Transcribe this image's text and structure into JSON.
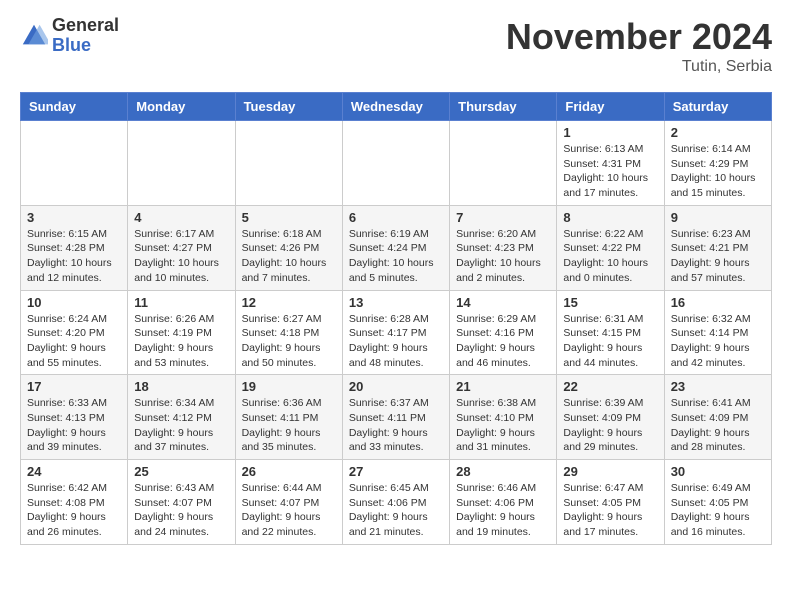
{
  "logo": {
    "general": "General",
    "blue": "Blue"
  },
  "header": {
    "month": "November 2024",
    "location": "Tutin, Serbia"
  },
  "days_of_week": [
    "Sunday",
    "Monday",
    "Tuesday",
    "Wednesday",
    "Thursday",
    "Friday",
    "Saturday"
  ],
  "weeks": [
    [
      {
        "day": "",
        "info": ""
      },
      {
        "day": "",
        "info": ""
      },
      {
        "day": "",
        "info": ""
      },
      {
        "day": "",
        "info": ""
      },
      {
        "day": "",
        "info": ""
      },
      {
        "day": "1",
        "info": "Sunrise: 6:13 AM\nSunset: 4:31 PM\nDaylight: 10 hours and 17 minutes."
      },
      {
        "day": "2",
        "info": "Sunrise: 6:14 AM\nSunset: 4:29 PM\nDaylight: 10 hours and 15 minutes."
      }
    ],
    [
      {
        "day": "3",
        "info": "Sunrise: 6:15 AM\nSunset: 4:28 PM\nDaylight: 10 hours and 12 minutes."
      },
      {
        "day": "4",
        "info": "Sunrise: 6:17 AM\nSunset: 4:27 PM\nDaylight: 10 hours and 10 minutes."
      },
      {
        "day": "5",
        "info": "Sunrise: 6:18 AM\nSunset: 4:26 PM\nDaylight: 10 hours and 7 minutes."
      },
      {
        "day": "6",
        "info": "Sunrise: 6:19 AM\nSunset: 4:24 PM\nDaylight: 10 hours and 5 minutes."
      },
      {
        "day": "7",
        "info": "Sunrise: 6:20 AM\nSunset: 4:23 PM\nDaylight: 10 hours and 2 minutes."
      },
      {
        "day": "8",
        "info": "Sunrise: 6:22 AM\nSunset: 4:22 PM\nDaylight: 10 hours and 0 minutes."
      },
      {
        "day": "9",
        "info": "Sunrise: 6:23 AM\nSunset: 4:21 PM\nDaylight: 9 hours and 57 minutes."
      }
    ],
    [
      {
        "day": "10",
        "info": "Sunrise: 6:24 AM\nSunset: 4:20 PM\nDaylight: 9 hours and 55 minutes."
      },
      {
        "day": "11",
        "info": "Sunrise: 6:26 AM\nSunset: 4:19 PM\nDaylight: 9 hours and 53 minutes."
      },
      {
        "day": "12",
        "info": "Sunrise: 6:27 AM\nSunset: 4:18 PM\nDaylight: 9 hours and 50 minutes."
      },
      {
        "day": "13",
        "info": "Sunrise: 6:28 AM\nSunset: 4:17 PM\nDaylight: 9 hours and 48 minutes."
      },
      {
        "day": "14",
        "info": "Sunrise: 6:29 AM\nSunset: 4:16 PM\nDaylight: 9 hours and 46 minutes."
      },
      {
        "day": "15",
        "info": "Sunrise: 6:31 AM\nSunset: 4:15 PM\nDaylight: 9 hours and 44 minutes."
      },
      {
        "day": "16",
        "info": "Sunrise: 6:32 AM\nSunset: 4:14 PM\nDaylight: 9 hours and 42 minutes."
      }
    ],
    [
      {
        "day": "17",
        "info": "Sunrise: 6:33 AM\nSunset: 4:13 PM\nDaylight: 9 hours and 39 minutes."
      },
      {
        "day": "18",
        "info": "Sunrise: 6:34 AM\nSunset: 4:12 PM\nDaylight: 9 hours and 37 minutes."
      },
      {
        "day": "19",
        "info": "Sunrise: 6:36 AM\nSunset: 4:11 PM\nDaylight: 9 hours and 35 minutes."
      },
      {
        "day": "20",
        "info": "Sunrise: 6:37 AM\nSunset: 4:11 PM\nDaylight: 9 hours and 33 minutes."
      },
      {
        "day": "21",
        "info": "Sunrise: 6:38 AM\nSunset: 4:10 PM\nDaylight: 9 hours and 31 minutes."
      },
      {
        "day": "22",
        "info": "Sunrise: 6:39 AM\nSunset: 4:09 PM\nDaylight: 9 hours and 29 minutes."
      },
      {
        "day": "23",
        "info": "Sunrise: 6:41 AM\nSunset: 4:09 PM\nDaylight: 9 hours and 28 minutes."
      }
    ],
    [
      {
        "day": "24",
        "info": "Sunrise: 6:42 AM\nSunset: 4:08 PM\nDaylight: 9 hours and 26 minutes."
      },
      {
        "day": "25",
        "info": "Sunrise: 6:43 AM\nSunset: 4:07 PM\nDaylight: 9 hours and 24 minutes."
      },
      {
        "day": "26",
        "info": "Sunrise: 6:44 AM\nSunset: 4:07 PM\nDaylight: 9 hours and 22 minutes."
      },
      {
        "day": "27",
        "info": "Sunrise: 6:45 AM\nSunset: 4:06 PM\nDaylight: 9 hours and 21 minutes."
      },
      {
        "day": "28",
        "info": "Sunrise: 6:46 AM\nSunset: 4:06 PM\nDaylight: 9 hours and 19 minutes."
      },
      {
        "day": "29",
        "info": "Sunrise: 6:47 AM\nSunset: 4:05 PM\nDaylight: 9 hours and 17 minutes."
      },
      {
        "day": "30",
        "info": "Sunrise: 6:49 AM\nSunset: 4:05 PM\nDaylight: 9 hours and 16 minutes."
      }
    ]
  ]
}
